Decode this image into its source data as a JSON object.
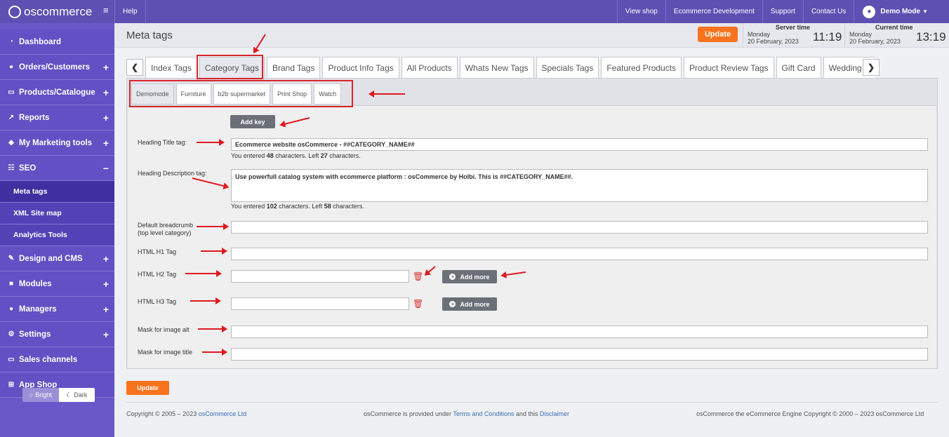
{
  "topbar": {
    "logo_text": "oscommerce",
    "links": [
      "Help"
    ],
    "right_links": [
      "View shop",
      "Ecommerce Development",
      "Support",
      "Contact Us"
    ],
    "user": "Demo Mode"
  },
  "sidebar": {
    "items": [
      {
        "label": "Dashboard",
        "icon": "dashboard-icon",
        "expand": ""
      },
      {
        "label": "Orders/Customers",
        "icon": "users-icon",
        "expand": "+"
      },
      {
        "label": "Products/Catalogue",
        "icon": "folder-icon",
        "expand": "+"
      },
      {
        "label": "Reports",
        "icon": "chart-icon",
        "expand": "+"
      },
      {
        "label": "My Marketing tools",
        "icon": "tag-icon",
        "expand": "+"
      },
      {
        "label": "SEO",
        "icon": "sitemap-icon",
        "expand": "−"
      }
    ],
    "seo_subitems": [
      "Meta tags",
      "XML Site map",
      "Analytics Tools"
    ],
    "items_after": [
      {
        "label": "Design and CMS",
        "icon": "brush-icon",
        "expand": "+"
      },
      {
        "label": "Modules",
        "icon": "modules-icon",
        "expand": "+"
      },
      {
        "label": "Managers",
        "icon": "user-icon",
        "expand": "+"
      },
      {
        "label": "Settings",
        "icon": "gears-icon",
        "expand": "+"
      },
      {
        "label": "Sales channels",
        "icon": "monitor-icon",
        "expand": ""
      },
      {
        "label": "App Shop",
        "icon": "cart-icon",
        "expand": ""
      }
    ],
    "theme": {
      "bright": "Bright",
      "dark": "Dark"
    }
  },
  "header": {
    "title": "Meta tags",
    "update_label": "Update",
    "server_time": {
      "label": "Server time",
      "day": "Monday",
      "date": "20 February, 2023",
      "time": "11:19"
    },
    "current_time": {
      "label": "Current time",
      "day": "Monday",
      "date": "20 February, 2023",
      "time": "13:19"
    }
  },
  "tabs": [
    "Index Tags",
    "Category Tags",
    "Brand Tags",
    "Product Info Tags",
    "All Products",
    "Whats New Tags",
    "Specials Tags",
    "Featured Products",
    "Product Review Tags",
    "Gift Card",
    "Wedding Regis"
  ],
  "active_tab": "Category Tags",
  "subtabs": [
    "Demomode",
    "Furniture",
    "b2b supermarket",
    "Print Shop",
    "Watch"
  ],
  "form": {
    "add_key": "Add key",
    "heading_title_label": "Heading Title tag:",
    "heading_title_value": "Ecommerce website osCommerce - ##CATEGORY_NAME##",
    "heading_title_counter": {
      "prefix": "You entered ",
      "count": "48",
      "mid": " characters. Left ",
      "left": "27",
      "suffix": " characters."
    },
    "heading_desc_label": "Heading Description tag:",
    "heading_desc_value": "Use powerfull catalog system with ecommerce platform : osCommerce by Holbi. This is ##CATEGORY_NAME##.",
    "heading_desc_counter": {
      "prefix": "You entered ",
      "count": "102",
      "mid": " characters. Left ",
      "left": "58",
      "suffix": " characters."
    },
    "breadcrumb_label_1": "Default breadcrumb",
    "breadcrumb_label_2": "(top level category)",
    "h1_label": "HTML H1 Tag",
    "h2_label": "HTML H2 Tag",
    "h3_label": "HTML H3 Tag",
    "add_more": "Add more",
    "image_alt_label": "Mask for image alt",
    "image_title_label": "Mask for image title",
    "update_label": "Update"
  },
  "footer": {
    "left_prefix": "Copyright © 2005 – 2023 ",
    "left_link": "osCommerce Ltd",
    "mid_prefix": "osCommerce is provided under ",
    "mid_link1": "Terms and Conditions",
    "mid_and": " and this ",
    "mid_link2": "Disclaimer",
    "right": "osCommerce the eCommerce Engine Copyright © 2000 – 2023 osCommerce Ltd"
  },
  "colors": {
    "accent": "#6250c4",
    "orange": "#f7731d",
    "annotation_red": "#e0191f"
  }
}
